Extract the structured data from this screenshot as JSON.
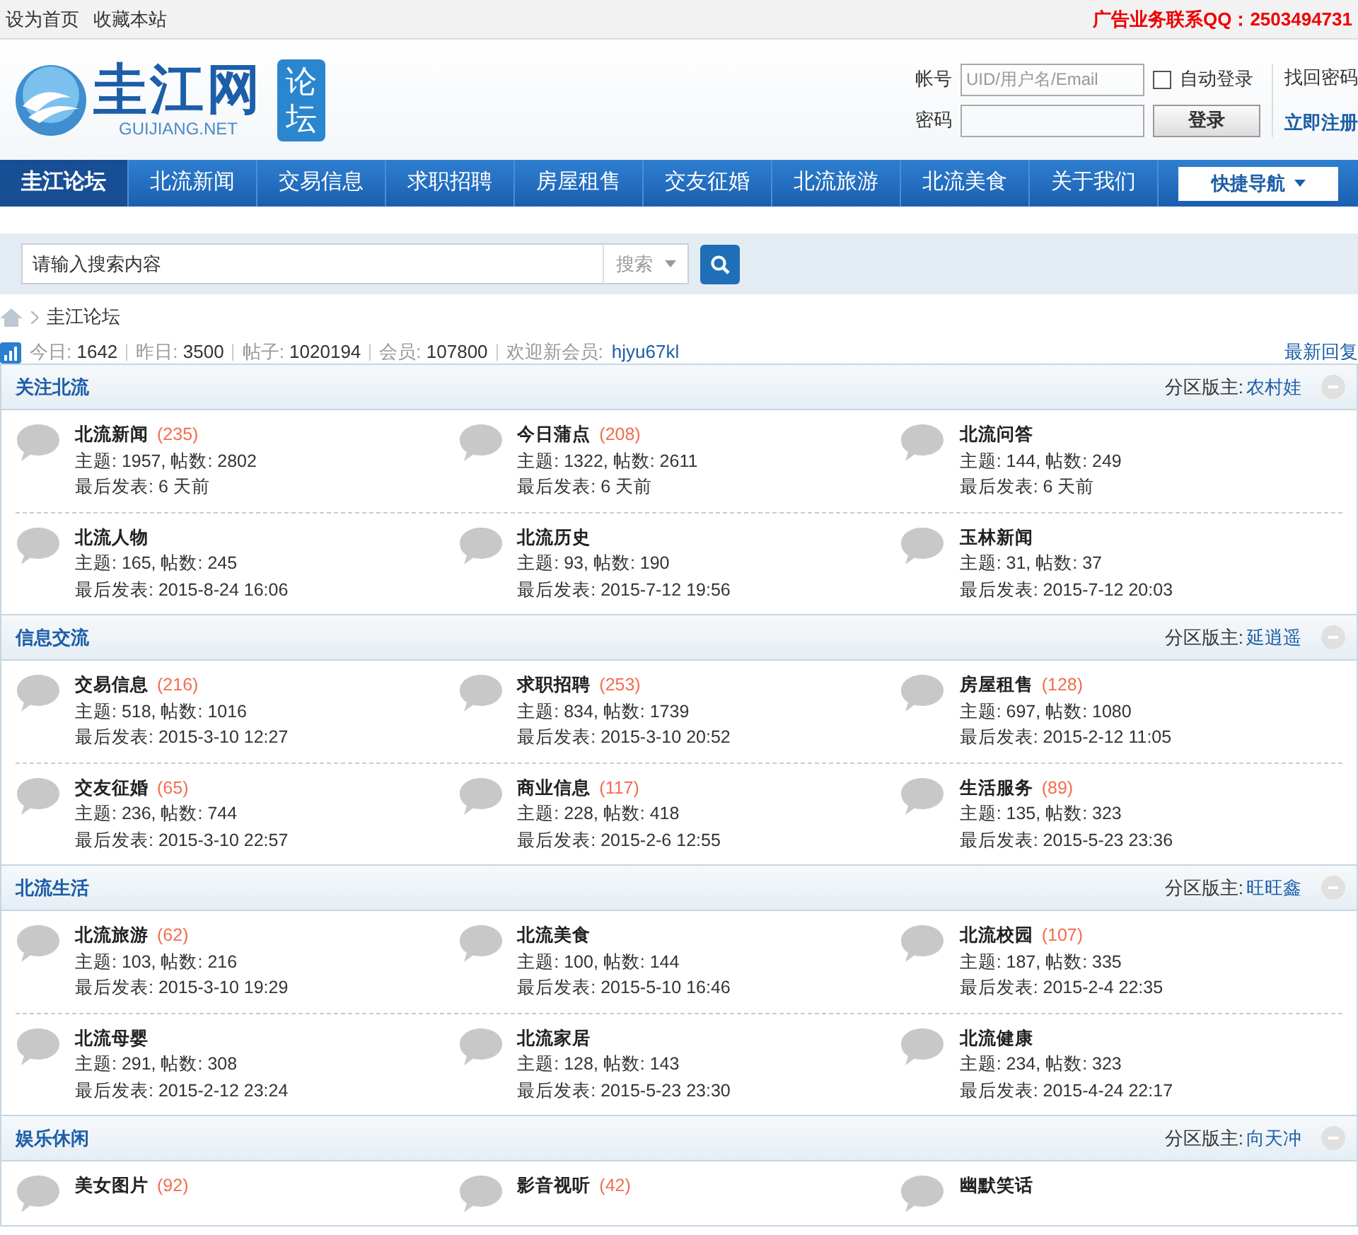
{
  "top_bar": {
    "links": [
      "设为首页",
      "收藏本站"
    ],
    "ad": "广告业务联系QQ：2503494731"
  },
  "header": {
    "logo": {
      "name": "圭江网",
      "domain": "GUIJIANG.NET",
      "badge": "论坛"
    },
    "login": {
      "account_label": "帐号",
      "account_placeholder": "UID/用户名/Email",
      "auto_login_label": "自动登录",
      "auto_login_checked": false,
      "password_label": "密码",
      "login_button": "登录",
      "forgot": "找回密码",
      "register": "立即注册"
    }
  },
  "nav": {
    "items": [
      {
        "label": "圭江论坛",
        "selected": true
      },
      {
        "label": "北流新闻",
        "selected": false
      },
      {
        "label": "交易信息",
        "selected": false
      },
      {
        "label": "求职招聘",
        "selected": false
      },
      {
        "label": "房屋租售",
        "selected": false
      },
      {
        "label": "交友征婚",
        "selected": false
      },
      {
        "label": "北流旅游",
        "selected": false
      },
      {
        "label": "北流美食",
        "selected": false
      },
      {
        "label": "关于我们",
        "selected": false
      }
    ],
    "quick_nav": "快捷导航"
  },
  "search": {
    "placeholder": "请输入搜索内容",
    "type": "搜索"
  },
  "breadcrumb": [
    "圭江论坛"
  ],
  "stats": {
    "items": [
      {
        "label": "今日:",
        "value": "1642"
      },
      {
        "label": "昨日:",
        "value": "3500"
      },
      {
        "label": "帖子:",
        "value": "1020194"
      },
      {
        "label": "会员:",
        "value": "107800"
      }
    ],
    "welcome": "欢迎新会员:",
    "new_member": "hjyu67kl",
    "latest": "最新回复"
  },
  "sections": [
    {
      "title": "关注北流",
      "moderator_label": "分区版主:",
      "moderator": "农村娃",
      "expanded": true,
      "forums": [
        {
          "name": "北流新闻",
          "count": "(235)",
          "stats": "主题: 1957, 帖数: 2802",
          "last": "最后发表: 6 天前"
        },
        {
          "name": "今日蒲点",
          "count": "(208)",
          "stats": "主题: 1322, 帖数: 2611",
          "last": "最后发表: 6 天前"
        },
        {
          "name": "北流问答",
          "stats": "主题: 144, 帖数: 249",
          "last": "最后发表: 6 天前"
        },
        {
          "name": "北流人物",
          "stats": "主题: 165, 帖数: 245",
          "last": "最后发表: 2015-8-24 16:06"
        },
        {
          "name": "北流历史",
          "stats": "主题: 93, 帖数: 190",
          "last": "最后发表: 2015-7-12 19:56"
        },
        {
          "name": "玉林新闻",
          "stats": "主题: 31, 帖数: 37",
          "last": "最后发表: 2015-7-12 20:03"
        }
      ]
    },
    {
      "title": "信息交流",
      "moderator_label": "分区版主:",
      "moderator": "延逍遥",
      "expanded": true,
      "forums": [
        {
          "name": "交易信息",
          "count": "(216)",
          "stats": "主题: 518, 帖数: 1016",
          "last": "最后发表: 2015-3-10 12:27"
        },
        {
          "name": "求职招聘",
          "count": "(253)",
          "stats": "主题: 834, 帖数: 1739",
          "last": "最后发表: 2015-3-10 20:52"
        },
        {
          "name": "房屋租售",
          "count": "(128)",
          "stats": "主题: 697, 帖数: 1080",
          "last": "最后发表: 2015-2-12 11:05"
        },
        {
          "name": "交友征婚",
          "count": "(65)",
          "stats": "主题: 236, 帖数: 744",
          "last": "最后发表: 2015-3-10 22:57"
        },
        {
          "name": "商业信息",
          "count": "(117)",
          "stats": "主题: 228, 帖数: 418",
          "last": "最后发表: 2015-2-6 12:55"
        },
        {
          "name": "生活服务",
          "count": "(89)",
          "stats": "主题: 135, 帖数: 323",
          "last": "最后发表: 2015-5-23 23:36"
        }
      ]
    },
    {
      "title": "北流生活",
      "moderator_label": "分区版主:",
      "moderator": "旺旺鑫",
      "expanded": true,
      "forums": [
        {
          "name": "北流旅游",
          "count": "(62)",
          "stats": "主题: 103, 帖数: 216",
          "last": "最后发表: 2015-3-10 19:29"
        },
        {
          "name": "北流美食",
          "stats": "主题: 100, 帖数: 144",
          "last": "最后发表: 2015-5-10 16:46"
        },
        {
          "name": "北流校园",
          "count": "(107)",
          "stats": "主题: 187, 帖数: 335",
          "last": "最后发表: 2015-2-4 22:35"
        },
        {
          "name": "北流母婴",
          "stats": "主题: 291, 帖数: 308",
          "last": "最后发表: 2015-2-12 23:24"
        },
        {
          "name": "北流家居",
          "stats": "主题: 128, 帖数: 143",
          "last": "最后发表: 2015-5-23 23:30"
        },
        {
          "name": "北流健康",
          "stats": "主题: 234, 帖数: 323",
          "last": "最后发表: 2015-4-24 22:17"
        }
      ]
    },
    {
      "title": "娱乐休闲",
      "moderator_label": "分区版主:",
      "moderator": "向天冲",
      "expanded": true,
      "forums": [
        {
          "name": "美女图片",
          "count": "(92)"
        },
        {
          "name": "影音视听",
          "count": "(42)"
        },
        {
          "name": "幽默笑话"
        }
      ]
    }
  ]
}
